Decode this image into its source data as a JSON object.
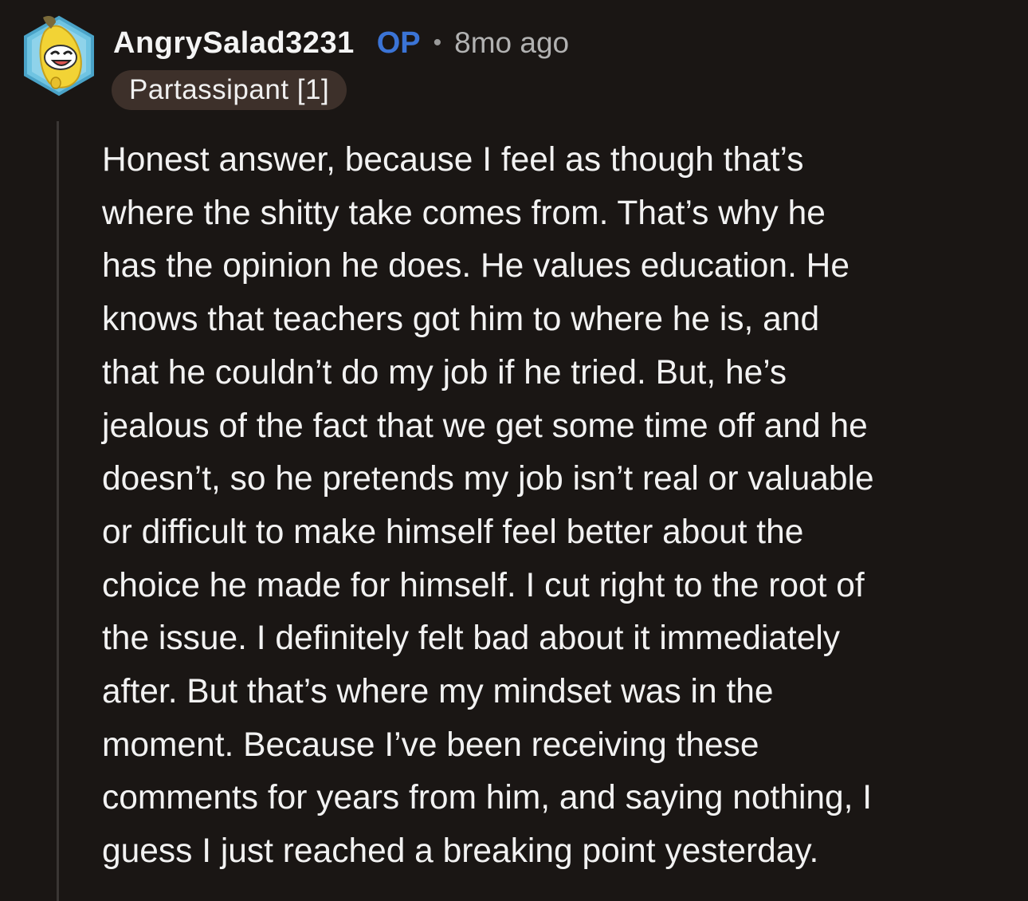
{
  "comment": {
    "username": "AngrySalad3231",
    "op_label": "OP",
    "separator": "•",
    "timestamp": "8mo ago",
    "flair": "Partassipant [1]",
    "avatar_icon": "banana-snoo-avatar-icon",
    "body_lines": [
      "Honest answer, because I feel as though that’s",
      "where the shitty take comes from. That’s why he",
      "has the opinion he does. He values education. He",
      "knows that teachers got him to where he is, and",
      "that he couldn’t do my job if he tried. But, he’s",
      "jealous of the fact that we get some time off and he",
      "doesn’t, so he pretends my job isn’t real or valuable",
      "or difficult to make himself feel better about the",
      "choice he made for himself. I cut right to the root of",
      "the issue. I definitely felt bad about it immediately",
      "after. But that’s where my mindset was in the",
      "moment. Because I’ve been receiving these",
      "comments for years from him, and saying nothing, I",
      "guess I just reached a breaking point yesterday."
    ]
  },
  "colors": {
    "background": "#1a1614",
    "op": "#3b74d6",
    "flair_bg": "#3d302a",
    "thread_line": "#3a3634"
  }
}
